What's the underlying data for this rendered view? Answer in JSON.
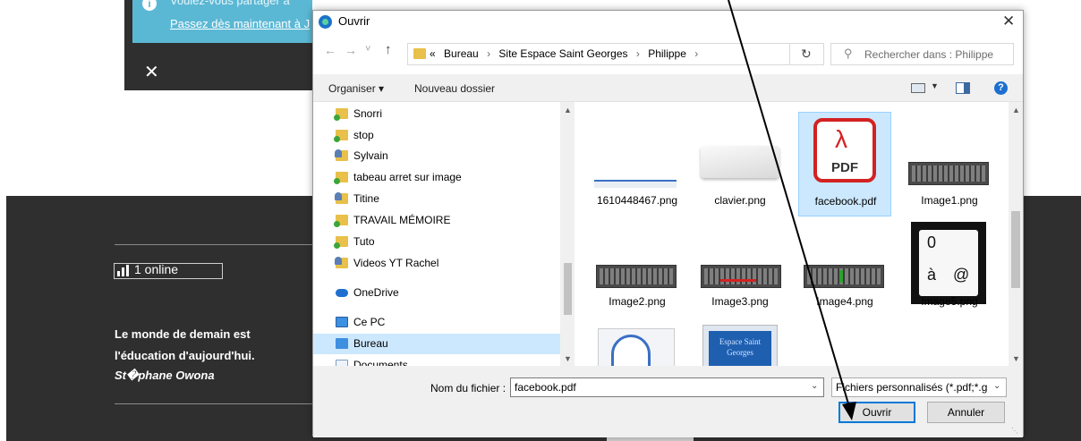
{
  "background_page": {
    "banner": {
      "line1": "Voulez-vous partager a",
      "line2": "Passez dès maintenant à J"
    },
    "close_glyph": "✕",
    "online_widget": {
      "text": "1 online"
    },
    "quote": {
      "line1": "Le monde de demain est",
      "line2": "l'éducation d'aujourd'hui.",
      "author": "St�phane Owona"
    }
  },
  "dialog": {
    "title": "Ouvrir",
    "close_glyph": "✕",
    "nav": {
      "back": "←",
      "forward": "→",
      "recent": "˅",
      "up": "↑"
    },
    "address": {
      "overflow": "«",
      "crumbs": [
        "Bureau",
        "Site Espace Saint Georges",
        "Philippe"
      ],
      "separator": "›"
    },
    "search": {
      "placeholder": "Rechercher dans : Philippe"
    },
    "toolbar": {
      "organize": "Organiser ▾",
      "new_folder": "Nouveau dossier",
      "help": "?"
    },
    "tree": [
      {
        "label": "Snorri",
        "icon": "folder-icon"
      },
      {
        "label": "stop",
        "icon": "folder-icon"
      },
      {
        "label": "Sylvain",
        "icon": "shared-folder-icon"
      },
      {
        "label": "tabeau arret sur image",
        "icon": "folder-icon"
      },
      {
        "label": "Titine",
        "icon": "shared-folder-icon"
      },
      {
        "label": "TRAVAIL MÉMOIRE",
        "icon": "folder-icon"
      },
      {
        "label": "Tuto",
        "icon": "folder-icon"
      },
      {
        "label": "Videos YT Rachel",
        "icon": "shared-folder-icon"
      },
      {
        "label": "OneDrive",
        "icon": "onedrive-icon"
      },
      {
        "label": "Ce PC",
        "icon": "pc-icon"
      },
      {
        "label": "Bureau",
        "icon": "desktop-icon",
        "selected": true
      },
      {
        "label": "Documents",
        "icon": "documents-icon"
      }
    ],
    "files": [
      {
        "name": "1610448467.png"
      },
      {
        "name": "clavier.png"
      },
      {
        "name": "facebook.pdf",
        "selected": true,
        "pdf_label": "PDF"
      },
      {
        "name": "Image1.png"
      },
      {
        "name": "Image2.png"
      },
      {
        "name": "Image3.png"
      },
      {
        "name": "Image4.png"
      },
      {
        "name": "Image5.png",
        "glyphs": [
          "0",
          "à",
          "@"
        ]
      },
      {
        "name": "",
        "partial": true
      },
      {
        "name": "",
        "partial": true,
        "thumb_text": "Espace Saint Georges"
      }
    ],
    "footer": {
      "filename_label": "Nom du fichier :",
      "filename_value": "facebook.pdf",
      "filetype": "Fichiers personnalisés (*.pdf;*.g",
      "open_button": "Ouvrir",
      "cancel_button": "Annuler"
    }
  },
  "colors": {
    "accent": "#0078d7",
    "selection": "#cce8ff",
    "banner": "#5bb8d4",
    "page_dark": "#2f2f2f",
    "pdf_red": "#d32222"
  }
}
